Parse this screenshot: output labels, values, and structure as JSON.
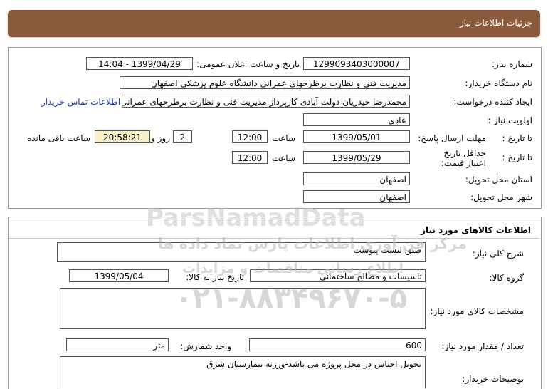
{
  "header": {
    "title": "جزئیات اطلاعات نیاز"
  },
  "need_info": {
    "need_number_label": "شماره نیاز:",
    "need_number": "1299093403000007",
    "announce_label": "تاریخ و ساعت اعلان عمومی:",
    "announce_value": "1399/04/29 - 14:04",
    "buyer_org_label": "نام دستگاه خریدار:",
    "buyer_org": "مدیریت فنی و نظارت برطرحهای عمرانی دانشگاه علوم پزشکی اصفهان",
    "creator_label": "ایجاد کننده درخواست:",
    "creator": "محمدرضا حیدریان دولت آبادی کارپرداز مدیریت فنی و نظارت برطرحهای عمرانی دا",
    "contact_link": "اطلاعات تماس خریدار",
    "priority_label": "اولویت نیاز :",
    "priority": "عادی",
    "reply_deadline_label": "مهلت ارسال پاسخ:",
    "to_date_label": "تا تاریخ :",
    "reply_date": "1399/05/01",
    "time_label": "ساعت",
    "reply_time": "12:00",
    "days": "2",
    "days_label": "روز و",
    "remaining_time": "20:58:21",
    "remaining_label": "ساعت باقی مانده",
    "price_validity_label": "حداقل تاریخ اعتبار قیمت:",
    "validity_to_date_label": "تا تاریخ :",
    "validity_date": "1399/05/29",
    "validity_time_label": "ساعت",
    "validity_time": "12:00",
    "province_label": "استان محل تحویل:",
    "province": "اصفهان",
    "city_label": "شهر محل تحویل:",
    "city": "اصفهان"
  },
  "goods": {
    "section_title": "اطلاعات کالاهای مورد نیاز",
    "summary_label": "شرح کلی نیاز:",
    "summary": "طبق لیست پیوست",
    "group_label": "گروه کالا:",
    "group": "تاسیسات و مصالح ساختمانی",
    "need_date_label": "تاریخ نیاز به کالا:",
    "need_date": "1399/05/04",
    "specs_label": "مشخصات کالای مورد نیاز:",
    "specs": "",
    "quantity_label": "تعداد / مقدار مورد نیاز:",
    "quantity": "600",
    "unit_label": "واحد شمارش:",
    "unit": "متر",
    "buyer_notes_label": "توضیحات خریدار:",
    "buyer_notes": "تحویل اجناس در محل پروژه می باشد-ورزنه بیمارستان شرق"
  },
  "watermark": {
    "brand": "ParsNamadData",
    "tagline": "مرکز فن آوری اطلاعات پارس نماد داده ها",
    "subtitle": "اطلاع رسانی مناقصات و مزایدات",
    "phone": "۰۲۱-۸۸۳۴۹۶۷۰-۵"
  }
}
